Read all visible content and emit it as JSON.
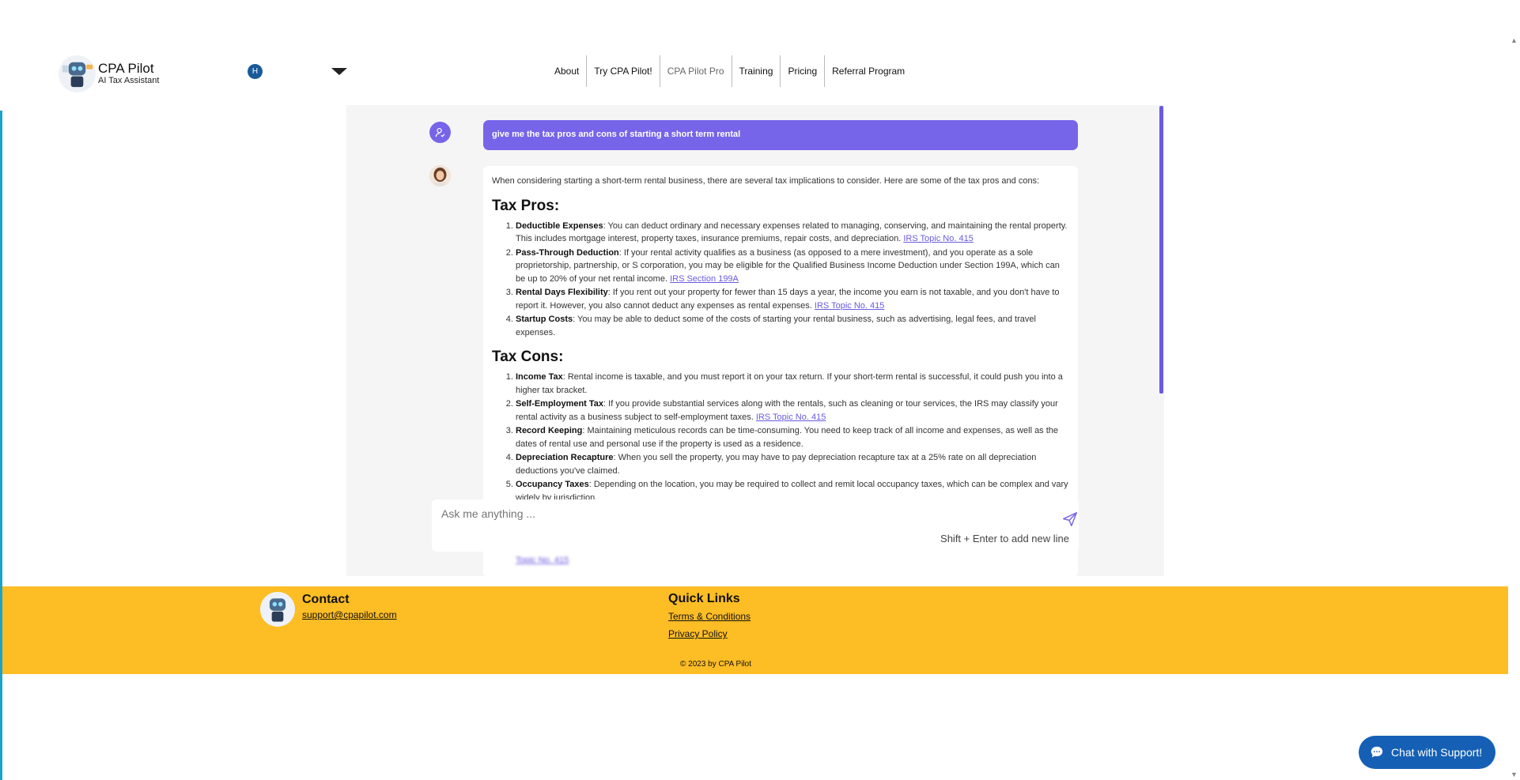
{
  "header": {
    "brand_name": "CPA Pilot",
    "brand_sub": "AI Tax Assistant",
    "avatar_letter": "H",
    "nav": [
      {
        "label": "About"
      },
      {
        "label": "Try CPA Pilot!"
      },
      {
        "label": "CPA Pilot Pro"
      },
      {
        "label": "Training"
      },
      {
        "label": "Pricing"
      },
      {
        "label": "Referral Program"
      }
    ]
  },
  "chat": {
    "user_message": "give me the tax pros and cons of starting a short term rental",
    "intro": "When considering starting a short-term rental business, there are several tax implications to consider. Here are some of the tax pros and cons:",
    "pros_title": "Tax Pros:",
    "pros": [
      {
        "term": "Deductible Expenses",
        "text": ": You can deduct ordinary and necessary expenses related to managing, conserving, and maintaining the rental property. This includes mortgage interest, property taxes, insurance premiums, repair costs, and depreciation. ",
        "link": "IRS Topic No. 415"
      },
      {
        "term": "Pass-Through Deduction",
        "text": ": If your rental activity qualifies as a business (as opposed to a mere investment), and you operate as a sole proprietorship, partnership, or S corporation, you may be eligible for the Qualified Business Income Deduction under Section 199A, which can be up to 20% of your net rental income. ",
        "link": "IRS Section 199A"
      },
      {
        "term": "Rental Days Flexibility",
        "text": ": If you rent out your property for fewer than 15 days a year, the income you earn is not taxable, and you don't have to report it. However, you also cannot deduct any expenses as rental expenses. ",
        "link": "IRS Topic No. 415"
      },
      {
        "term": "Startup Costs",
        "text": ": You may be able to deduct some of the costs of starting your rental business, such as advertising, legal fees, and travel expenses.",
        "link": ""
      }
    ],
    "cons_title": "Tax Cons:",
    "cons": [
      {
        "term": "Income Tax",
        "text": ": Rental income is taxable, and you must report it on your tax return. If your short-term rental is successful, it could push you into a higher tax bracket.",
        "link": ""
      },
      {
        "term": "Self-Employment Tax",
        "text": ": If you provide substantial services along with the rentals, such as cleaning or tour services, the IRS may classify your rental activity as a business subject to self-employment taxes. ",
        "link": "IRS Topic No. 415"
      },
      {
        "term": "Record Keeping",
        "text": ": Maintaining meticulous records can be time-consuming. You need to keep track of all income and expenses, as well as the dates of rental use and personal use if the property is used as a residence.",
        "link": ""
      },
      {
        "term": "Depreciation Recapture",
        "text": ": When you sell the property, you may have to pay depreciation recapture tax at a 25% rate on all depreciation deductions you've claimed.",
        "link": ""
      },
      {
        "term": "Occupancy Taxes",
        "text": ": Depending on the location, you may be required to collect and remit local occupancy taxes, which can be complex and vary widely by jurisdiction.",
        "link": ""
      }
    ],
    "blurred_link": "Topic No. 415"
  },
  "composer": {
    "placeholder": "Ask me anything ...",
    "hint": "Shift + Enter to add new line"
  },
  "footer": {
    "contact_title": "Contact",
    "contact_email": "support@cpapilot.com",
    "quick_links_title": "Quick Links",
    "terms": "Terms & Conditions",
    "privacy": "Privacy Policy",
    "copyright": "© 2023 by CPA Pilot"
  },
  "support_button": "Chat with Support!",
  "colors": {
    "accent": "#7665e8",
    "footer": "#fdbd25",
    "support": "#1560b5"
  }
}
